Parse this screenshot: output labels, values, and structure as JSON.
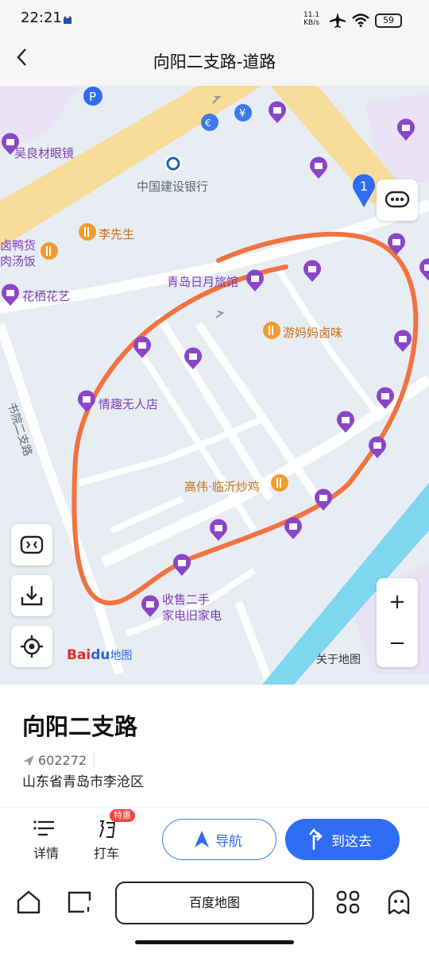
{
  "status_bar": {
    "time": "22:21",
    "net_speed": "11.1",
    "net_unit": "KB/s",
    "battery": "59"
  },
  "header": {
    "title": "向阳二支路-道路"
  },
  "map": {
    "roads": {
      "road_vertical": "书院二支路"
    },
    "pois": {
      "p1": "吴良材眼镜",
      "p2": "中国建设银行",
      "p3": "李先生",
      "p4": "卤鸭货",
      "p5": "肉汤饭",
      "p6": "花栖花艺",
      "p7": "青岛日月旅馆",
      "p8": "游妈妈卤味",
      "p9": "情趣无人店",
      "p10": "高伟·临沂炒鸡",
      "p11": "收售二手",
      "p12": "家电旧家电"
    },
    "marker_number": "1",
    "zoom_in": "+",
    "zoom_out": "−",
    "about": "关于地图",
    "logo_bai": "Bai",
    "logo_du": "du",
    "logo_ditu": "地图",
    "annotation_color": "#f07340"
  },
  "place": {
    "name": "向阳二支路",
    "code": "602272",
    "address": "山东省青岛市李沧区"
  },
  "actions": {
    "details": "详情",
    "taxi": "打车",
    "taxi_badge": "特惠",
    "navigate": "导航",
    "go_here": "到这去"
  },
  "tabbar": {
    "center": "百度地图"
  }
}
